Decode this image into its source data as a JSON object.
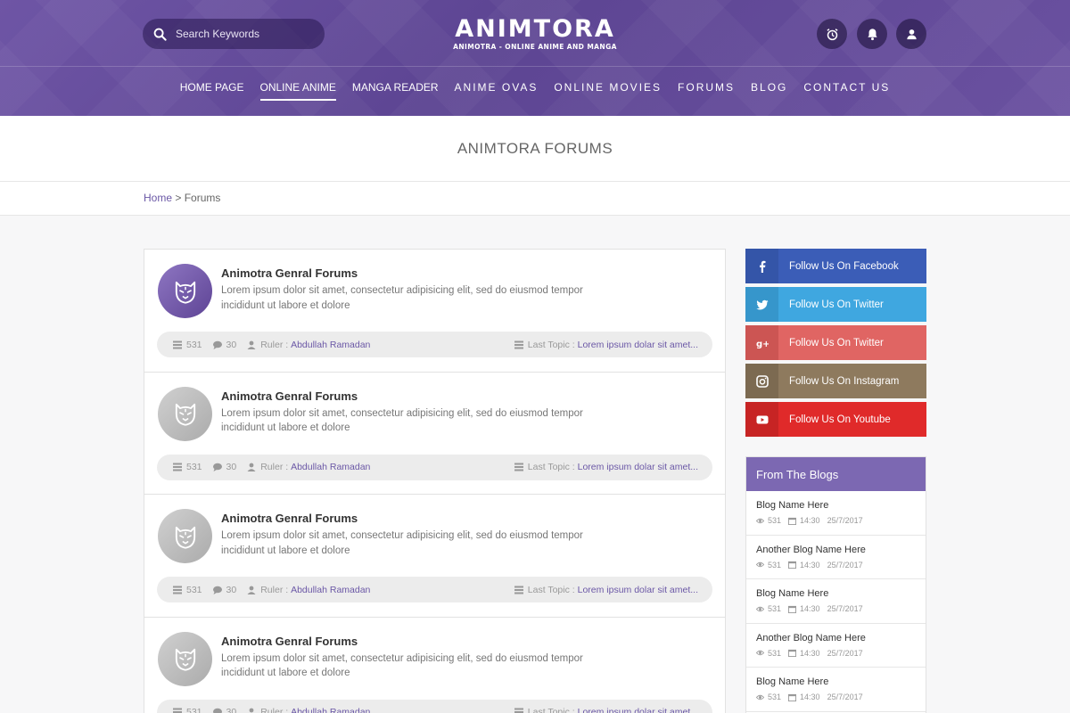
{
  "header": {
    "search": {
      "placeholder": "Search Keywords"
    },
    "logo": {
      "name": "ANIMTORA",
      "tagline": "ANIMOTRA - ONLINE ANIME AND MANGA"
    },
    "nav": [
      {
        "label": "HOME PAGE",
        "active": false
      },
      {
        "label": "ONLINE ANIME",
        "active": true
      },
      {
        "label": "MANGA READER",
        "active": false
      },
      {
        "label": "ANIME OVAS",
        "active": false
      },
      {
        "label": "ONLINE MOVIES",
        "active": false
      },
      {
        "label": "FORUMS",
        "active": false
      },
      {
        "label": "BLOG",
        "active": false
      },
      {
        "label": "CONTACT US",
        "active": false
      }
    ],
    "icons": [
      "alarm-icon",
      "bell-icon",
      "user-icon"
    ]
  },
  "page": {
    "title": "ANIMTORA FORUMS"
  },
  "breadcrumb": {
    "home": "Home",
    "separator": ">",
    "current": "Forums"
  },
  "forums": [
    {
      "title": "Animotra Genral Forums",
      "desc": "Lorem ipsum dolor sit amet, consectetur adipisicing elit, sed do eiusmod tempor incididunt ut labore et dolore",
      "topics": "531",
      "comments": "30",
      "ruler_label": "Ruler :",
      "ruler": "Abdullah Ramadan",
      "last_label": "Last Topic :",
      "last_topic": "Lorem ipsum dolar sit amet...",
      "avatar": "purple"
    },
    {
      "title": "Animotra Genral Forums",
      "desc": "Lorem ipsum dolor sit amet, consectetur adipisicing elit, sed do eiusmod tempor incididunt ut labore et dolore",
      "topics": "531",
      "comments": "30",
      "ruler_label": "Ruler :",
      "ruler": "Abdullah Ramadan",
      "last_label": "Last Topic :",
      "last_topic": "Lorem ipsum dolar sit amet...",
      "avatar": "gray"
    },
    {
      "title": "Animotra Genral Forums",
      "desc": "Lorem ipsum dolor sit amet, consectetur adipisicing elit, sed do eiusmod tempor incididunt ut labore et dolore",
      "topics": "531",
      "comments": "30",
      "ruler_label": "Ruler :",
      "ruler": "Abdullah Ramadan",
      "last_label": "Last Topic :",
      "last_topic": "Lorem ipsum dolar sit amet...",
      "avatar": "gray"
    },
    {
      "title": "Animotra Genral Forums",
      "desc": "Lorem ipsum dolor sit amet, consectetur adipisicing elit, sed do eiusmod tempor incididunt ut labore et dolore",
      "topics": "531",
      "comments": "30",
      "ruler_label": "Ruler :",
      "ruler": "Abdullah Ramadan",
      "last_label": "Last Topic :",
      "last_topic": "Lorem ipsum dolar sit amet...",
      "avatar": "gray"
    }
  ],
  "social": [
    {
      "label": "Follow Us On Facebook",
      "color": "#3b5db7",
      "icon_bg": "#3455a8",
      "icon": "facebook-icon"
    },
    {
      "label": "Follow Us On Twitter",
      "color": "#3fa7e0",
      "icon_bg": "#3696cb",
      "icon": "twitter-icon"
    },
    {
      "label": "Follow Us On Twitter",
      "color": "#e06563",
      "icon_bg": "#cc5553",
      "icon": "google-plus-icon"
    },
    {
      "label": "Follow Us On Instagram",
      "color": "#8e7a5e",
      "icon_bg": "#7c6a51",
      "icon": "instagram-icon"
    },
    {
      "label": "Follow Us On Youtube",
      "color": "#e02a2a",
      "icon_bg": "#c72424",
      "icon": "youtube-icon"
    }
  ],
  "blogs": {
    "title": "From The Blogs",
    "items": [
      {
        "name": "Blog Name Here",
        "views": "531",
        "time": "14:30",
        "date": "25/7/2017"
      },
      {
        "name": "Another Blog Name Here",
        "views": "531",
        "time": "14:30",
        "date": "25/7/2017"
      },
      {
        "name": "Blog Name Here",
        "views": "531",
        "time": "14:30",
        "date": "25/7/2017"
      },
      {
        "name": "Another Blog Name Here",
        "views": "531",
        "time": "14:30",
        "date": "25/7/2017"
      },
      {
        "name": "Blog Name Here",
        "views": "531",
        "time": "14:30",
        "date": "25/7/2017"
      }
    ]
  }
}
